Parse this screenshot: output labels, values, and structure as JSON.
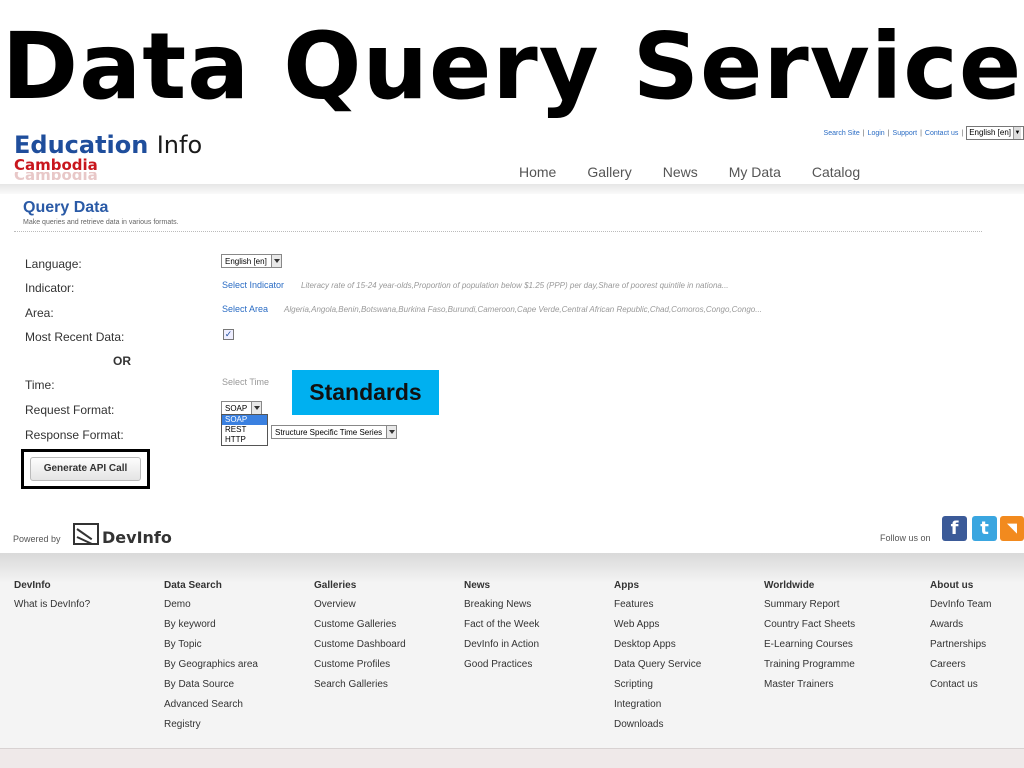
{
  "slide_title": "Data Query Service",
  "logo": {
    "main": "Education",
    "info": "Info",
    "sub": "Cambodia"
  },
  "utility": {
    "links": [
      "Search Site",
      "Login",
      "Support",
      "Contact us"
    ],
    "language": "English [en]"
  },
  "nav": [
    "Home",
    "Gallery",
    "News",
    "My Data",
    "Catalog"
  ],
  "section": {
    "title": "Query Data",
    "subtitle": "Make queries and retrieve data in various formats."
  },
  "form": {
    "language_label": "Language:",
    "language_value": "English [en]",
    "indicator_label": "Indicator:",
    "indicator_link": "Select Indicator",
    "indicator_hint": "Literacy rate of 15-24 year-olds,Proportion of population below $1.25 (PPP) per day,Share of poorest quintile in nationa...",
    "area_label": "Area:",
    "area_link": "Select Area",
    "area_hint": "Algeria,Angola,Benin,Botswana,Burkina Faso,Burundi,Cameroon,Cape Verde,Central African Republic,Chad,Comoros,Congo,Congo...",
    "most_recent_label": "Most Recent Data:",
    "most_recent_checked": true,
    "or_label": "OR",
    "time_label": "Time:",
    "time_placeholder": "Select Time",
    "request_label": "Request Format:",
    "request_value": "SOAP",
    "request_options": [
      "SOAP",
      "REST",
      "HTTP"
    ],
    "response_label": "Response Format:",
    "response_value": "Structure Specific Time Series",
    "generate_button": "Generate API Call"
  },
  "callout": "Standards",
  "powered_by": {
    "label": "Powered by",
    "brand": "DevInfo"
  },
  "follow": "Follow us on",
  "social_icons": [
    "facebook-icon",
    "twitter-icon",
    "rss-icon"
  ],
  "footer": [
    {
      "title": "DevInfo",
      "items": [
        "What is DevInfo?"
      ]
    },
    {
      "title": "Data Search",
      "items": [
        "Demo",
        "By keyword",
        "By Topic",
        "By Geographics area",
        "By Data Source",
        "Advanced Search",
        "Registry"
      ]
    },
    {
      "title": "Galleries",
      "items": [
        "Overview",
        "Custome Galleries",
        "Custome Dashboard",
        "Custome Profiles",
        "Search Galleries"
      ]
    },
    {
      "title": "News",
      "items": [
        "Breaking News",
        "Fact of the Week",
        "DevInfo in Action",
        "Good Practices"
      ]
    },
    {
      "title": "Apps",
      "items": [
        "Features",
        "Web Apps",
        "Desktop Apps",
        "Data Query Service",
        "Scripting",
        "Integration",
        "Downloads"
      ]
    },
    {
      "title": "Worldwide",
      "items": [
        "Summary Report",
        "Country Fact Sheets",
        "E-Learning Courses",
        "Training Programme",
        "Master Trainers"
      ]
    },
    {
      "title": "About us",
      "items": [
        "DevInfo Team",
        "Awards",
        "Partnerships",
        "Careers",
        "Contact us"
      ]
    }
  ],
  "colors": {
    "callout": "#00b0f0",
    "link": "#2a6cc4",
    "brand_blue": "#1f4e9c",
    "brand_red": "#c8161d"
  }
}
